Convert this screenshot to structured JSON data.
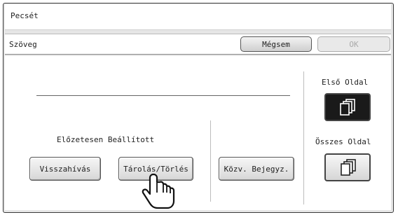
{
  "window": {
    "title": "Pecsét"
  },
  "subheader": {
    "label": "Szöveg",
    "cancel_label": "Mégsem",
    "ok_label": "OK"
  },
  "preset": {
    "heading": "Előzetesen Beállított",
    "recall_label": "Visszahívás",
    "store_delete_label": "Tárolás/Törlés",
    "direct_entry_label": "Közv. Bejegyz."
  },
  "pages": {
    "first_page_label": "Első Oldal",
    "all_pages_label": "Összes Oldal",
    "first_page_icon": "pages-stack-icon",
    "all_pages_icon": "pages-stack-icon",
    "selected": "first_page"
  },
  "pointer": {
    "icon": "hand-pointer-icon"
  }
}
